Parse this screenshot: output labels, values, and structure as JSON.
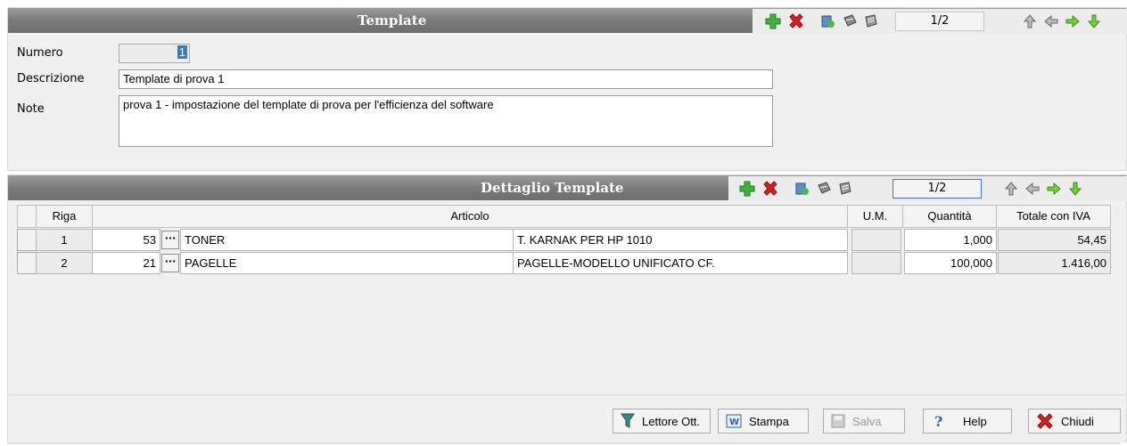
{
  "header": {
    "title": "Template",
    "position": "1/2"
  },
  "form": {
    "numero_label": "Numero",
    "numero_value": "1",
    "descrizione_label": "Descrizione",
    "descrizione_value": "Template di prova 1",
    "note_label": "Note",
    "note_value": "prova 1 - impostazione del template di prova per l'efficienza del software"
  },
  "detail": {
    "title": "Dettaglio Template",
    "position": "1/2",
    "columns": {
      "riga": "Riga",
      "articolo": "Articolo",
      "um": "U.M.",
      "quantita": "Quantità",
      "totale": "Totale con IVA"
    },
    "rows": [
      {
        "riga": "1",
        "code": "53",
        "name": "TONER",
        "desc": "T. KARNAK PER HP 1010",
        "um": "",
        "qty": "1,000",
        "total": "54,45"
      },
      {
        "riga": "2",
        "code": "21",
        "name": "PAGELLE",
        "desc": "PAGELLE-MODELLO UNIFICATO CF.",
        "um": "",
        "qty": "100,000",
        "total": "1.416,00"
      }
    ]
  },
  "buttons": {
    "lettore": "Lettore Ott.",
    "stampa": "Stampa",
    "salva": "Salva",
    "help": "Help",
    "chiudi": "Chiudi"
  },
  "icons": {
    "add": "plus-icon",
    "delete": "x-icon",
    "first": "arrow-up-icon",
    "prev": "arrow-left-icon",
    "next": "arrow-right-icon",
    "last": "arrow-down-icon"
  },
  "colors": {
    "add_green": "#3cb33c",
    "delete_red": "#d42020",
    "selection_blue": "#3a78c8"
  }
}
